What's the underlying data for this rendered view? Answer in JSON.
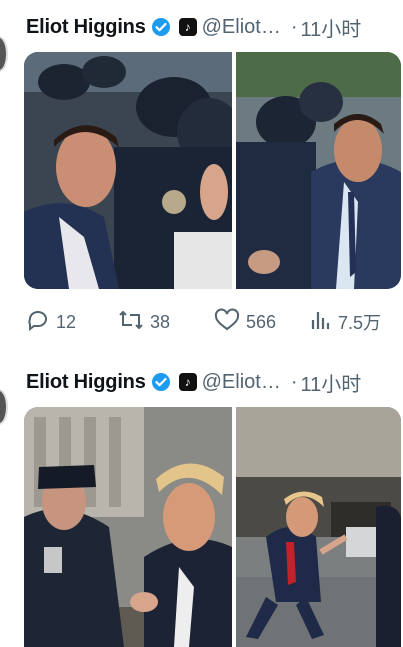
{
  "post1": {
    "author_name": "Eliot Higgins",
    "handle": "@Eliot…",
    "time": "11小时",
    "actions": {
      "replies": "12",
      "reposts": "38",
      "likes": "566",
      "views": "7.5万"
    }
  },
  "post2": {
    "author_name": "Eliot Higgins",
    "handle": "@Eliot…",
    "time": "11小时"
  },
  "icons": {
    "verified": "verified-badge-icon",
    "tiktok": "tiktok-icon",
    "reply": "reply-icon",
    "repost": "repost-icon",
    "like": "heart-icon",
    "views": "views-icon"
  },
  "colors": {
    "verified": "#1d9bf0",
    "secondary_text": "#536471",
    "text": "#0f1419"
  }
}
